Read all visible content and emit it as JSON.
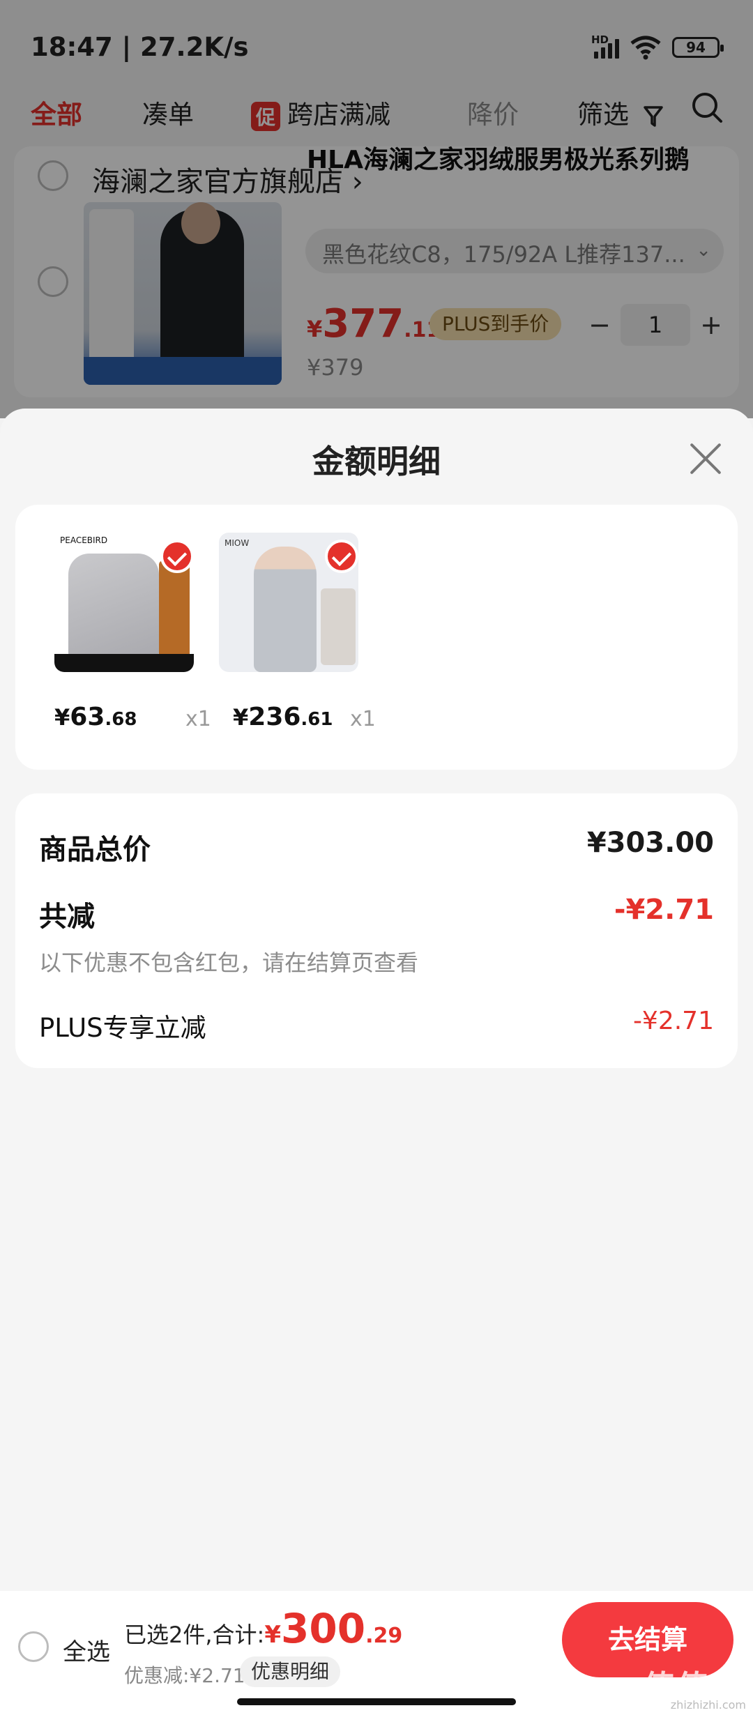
{
  "status_bar": {
    "time": "18:47 | 27.2K/s",
    "hd_label": "HD",
    "battery": "94"
  },
  "filter_tabs": {
    "all": "全部",
    "bundle": "凑单",
    "promo_badge": "促",
    "cross_store": "跨店满减",
    "price_drop": "降价",
    "filter": "筛选"
  },
  "store": {
    "name": "海澜之家官方旗舰店",
    "item": {
      "title": "HLA海澜之家羽绒服男极光系列鹅",
      "sku": "黑色花纹C8，175/92A L推荐137...",
      "price_currency": "¥",
      "price_int": "377",
      "price_dec": ".11",
      "plus_tag": "PLUS到手价",
      "quantity": "1",
      "original_price": "¥379"
    }
  },
  "sheet": {
    "title": "金额明细",
    "products": [
      {
        "currency": "¥",
        "price_int": "63",
        "price_dec": ".68",
        "qty": "x1",
        "brand": "PEACEBIRD"
      },
      {
        "currency": "¥",
        "price_int": "236",
        "price_dec": ".61",
        "qty": "x1",
        "brand": "MIOW"
      }
    ],
    "summary": {
      "total_label": "商品总价",
      "total_value": "¥303.00",
      "discount_label": "共减",
      "discount_value": "-¥2.71",
      "note": "以下优惠不包含红包，请在结算页查看",
      "plus_label": "PLUS专享立减",
      "plus_value": "-¥2.71"
    }
  },
  "checkout": {
    "select_all": "全选",
    "selected_text": "已选2件,合计:",
    "currency": "¥",
    "total_int": "300",
    "total_dec": ".29",
    "discount_text": "优惠减:¥2.71",
    "detail_chip": "优惠明细",
    "button": "去结算"
  },
  "watermark": "zhizhizhi.com",
  "watermark_big": "值值值",
  "colors": {
    "accent": "#e4312b",
    "checkout_button": "#f43a3f",
    "plus_tag": "#f4dfae"
  }
}
